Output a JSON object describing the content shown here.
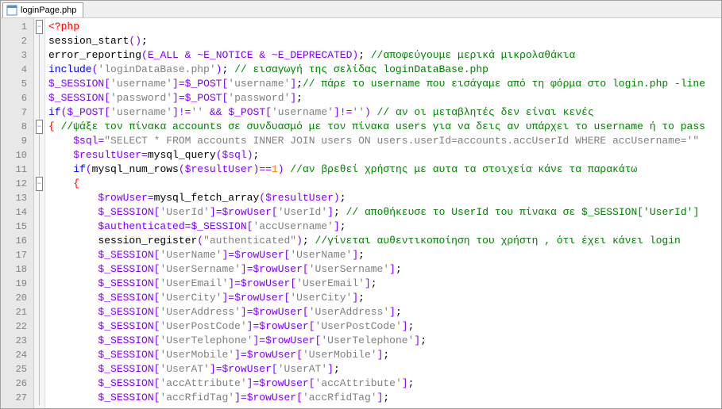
{
  "tab": {
    "filename": "loginPage.php"
  },
  "lines": [
    {
      "n": 1,
      "fold": "minus",
      "tokens": [
        [
          "c-tag",
          "<?php"
        ]
      ]
    },
    {
      "n": 2,
      "fold": "line",
      "tokens": [
        [
          "",
          "session_start"
        ],
        [
          "c-paren",
          "()"
        ],
        [
          "c-punc",
          ";"
        ]
      ]
    },
    {
      "n": 3,
      "fold": "line",
      "tokens": [
        [
          "",
          "error_reporting"
        ],
        [
          "c-paren",
          "("
        ],
        [
          "c-idx",
          "E_ALL"
        ],
        [
          "",
          " "
        ],
        [
          "c-op",
          "&"
        ],
        [
          "",
          " "
        ],
        [
          "c-op",
          "~"
        ],
        [
          "c-idx",
          "E_NOTICE"
        ],
        [
          "",
          " "
        ],
        [
          "c-op",
          "&"
        ],
        [
          "",
          " "
        ],
        [
          "c-op",
          "~"
        ],
        [
          "c-idx",
          "E_DEPRECATED"
        ],
        [
          "c-paren",
          ")"
        ],
        [
          "c-punc",
          ";"
        ],
        [
          "",
          " "
        ],
        [
          "c-com",
          "//αποφεύγουμε μερικά μικρολαθάκια"
        ]
      ]
    },
    {
      "n": 4,
      "fold": "line",
      "tokens": [
        [
          "c-kw",
          "include"
        ],
        [
          "c-paren",
          "("
        ],
        [
          "c-str",
          "'loginDataBase.php'"
        ],
        [
          "c-paren",
          ")"
        ],
        [
          "c-punc",
          ";"
        ],
        [
          "",
          " "
        ],
        [
          "c-com",
          "// εισαγωγή της σελίδας loginDataBase.php"
        ]
      ]
    },
    {
      "n": 5,
      "fold": "line",
      "tokens": [
        [
          "c-idx",
          "$_SESSION"
        ],
        [
          "c-paren",
          "["
        ],
        [
          "c-str",
          "'username'"
        ],
        [
          "c-paren",
          "]"
        ],
        [
          "c-op",
          "="
        ],
        [
          "c-idx",
          "$_POST"
        ],
        [
          "c-paren",
          "["
        ],
        [
          "c-str",
          "'username'"
        ],
        [
          "c-paren",
          "]"
        ],
        [
          "c-punc",
          ";"
        ],
        [
          "c-com",
          "// πάρε το username που εισάγαμε από τη φόρμα στο login.php -line"
        ]
      ]
    },
    {
      "n": 6,
      "fold": "line",
      "tokens": [
        [
          "c-idx",
          "$_SESSION"
        ],
        [
          "c-paren",
          "["
        ],
        [
          "c-str",
          "'password'"
        ],
        [
          "c-paren",
          "]"
        ],
        [
          "c-op",
          "="
        ],
        [
          "c-idx",
          "$_POST"
        ],
        [
          "c-paren",
          "["
        ],
        [
          "c-str",
          "'password'"
        ],
        [
          "c-paren",
          "]"
        ],
        [
          "c-punc",
          ";"
        ]
      ]
    },
    {
      "n": 7,
      "fold": "line",
      "tokens": [
        [
          "c-kw",
          "if"
        ],
        [
          "c-paren",
          "("
        ],
        [
          "c-idx",
          "$_POST"
        ],
        [
          "c-paren",
          "["
        ],
        [
          "c-str",
          "'username'"
        ],
        [
          "c-paren",
          "]"
        ],
        [
          "c-op",
          "!="
        ],
        [
          "c-str",
          "''"
        ],
        [
          "",
          " "
        ],
        [
          "c-op",
          "&&"
        ],
        [
          "",
          " "
        ],
        [
          "c-idx",
          "$_POST"
        ],
        [
          "c-paren",
          "["
        ],
        [
          "c-str",
          "'username'"
        ],
        [
          "c-paren",
          "]"
        ],
        [
          "c-op",
          "!="
        ],
        [
          "c-str",
          "''"
        ],
        [
          "c-paren",
          ")"
        ],
        [
          "",
          " "
        ],
        [
          "c-com",
          "// αν οι μεταβλητές δεν είναι κενές"
        ]
      ]
    },
    {
      "n": 8,
      "fold": "minus",
      "tokens": [
        [
          "c-brace",
          "{"
        ],
        [
          "",
          " "
        ],
        [
          "c-com",
          "//ψάξε τον πίνακα accounts σε συνδυασμό με τον πίνακα users για να δεις αν υπάρχει το username ή το pass"
        ]
      ]
    },
    {
      "n": 9,
      "fold": "line",
      "tokens": [
        [
          "",
          "    "
        ],
        [
          "c-idx",
          "$sql"
        ],
        [
          "c-op",
          "="
        ],
        [
          "c-str",
          "\"SELECT * FROM accounts INNER JOIN users ON users.userId=accounts.accUserId WHERE accUsername='\""
        ]
      ]
    },
    {
      "n": 10,
      "fold": "line",
      "tokens": [
        [
          "",
          "    "
        ],
        [
          "c-idx",
          "$resultUser"
        ],
        [
          "c-op",
          "="
        ],
        [
          "",
          "mysql_query"
        ],
        [
          "c-paren",
          "("
        ],
        [
          "c-idx",
          "$sql"
        ],
        [
          "c-paren",
          ")"
        ],
        [
          "c-punc",
          ";"
        ]
      ]
    },
    {
      "n": 11,
      "fold": "line",
      "tokens": [
        [
          "",
          "    "
        ],
        [
          "c-kw",
          "if"
        ],
        [
          "c-paren",
          "("
        ],
        [
          "",
          "mysql_num_rows"
        ],
        [
          "c-paren",
          "("
        ],
        [
          "c-idx",
          "$resultUser"
        ],
        [
          "c-paren",
          ")"
        ],
        [
          "c-op",
          "=="
        ],
        [
          "c-num",
          "1"
        ],
        [
          "c-paren",
          ")"
        ],
        [
          "",
          " "
        ],
        [
          "c-com",
          "//αν βρεθεί χρήστης με αυτα τα στοιχεία κάνε τα παρακάτω"
        ]
      ]
    },
    {
      "n": 12,
      "fold": "minus",
      "tokens": [
        [
          "",
          "    "
        ],
        [
          "c-brace",
          "{"
        ]
      ]
    },
    {
      "n": 13,
      "fold": "line",
      "tokens": [
        [
          "",
          "        "
        ],
        [
          "c-idx",
          "$rowUser"
        ],
        [
          "c-op",
          "="
        ],
        [
          "",
          "mysql_fetch_array"
        ],
        [
          "c-paren",
          "("
        ],
        [
          "c-idx",
          "$resultUser"
        ],
        [
          "c-paren",
          ")"
        ],
        [
          "c-punc",
          ";"
        ]
      ]
    },
    {
      "n": 14,
      "fold": "line",
      "tokens": [
        [
          "",
          "        "
        ],
        [
          "c-idx",
          "$_SESSION"
        ],
        [
          "c-paren",
          "["
        ],
        [
          "c-str",
          "'UserId'"
        ],
        [
          "c-paren",
          "]"
        ],
        [
          "c-op",
          "="
        ],
        [
          "c-idx",
          "$rowUser"
        ],
        [
          "c-paren",
          "["
        ],
        [
          "c-str",
          "'UserId'"
        ],
        [
          "c-paren",
          "]"
        ],
        [
          "c-punc",
          ";"
        ],
        [
          "",
          " "
        ],
        [
          "c-com",
          "// αποθήκευσε το UserId του πίνακα σε $_SESSION['UserId']"
        ]
      ]
    },
    {
      "n": 15,
      "fold": "line",
      "tokens": [
        [
          "",
          "        "
        ],
        [
          "c-idx",
          "$authenticated"
        ],
        [
          "c-op",
          "="
        ],
        [
          "c-idx",
          "$_SESSION"
        ],
        [
          "c-paren",
          "["
        ],
        [
          "c-str",
          "'accUsername'"
        ],
        [
          "c-paren",
          "]"
        ],
        [
          "c-punc",
          ";"
        ]
      ]
    },
    {
      "n": 16,
      "fold": "line",
      "tokens": [
        [
          "",
          "        "
        ],
        [
          "",
          "session_register"
        ],
        [
          "c-paren",
          "("
        ],
        [
          "c-str",
          "\"authenticated\""
        ],
        [
          "c-paren",
          ")"
        ],
        [
          "c-punc",
          ";"
        ],
        [
          "",
          " "
        ],
        [
          "c-com",
          "//γίνεται αυθεντικοποίηση του χρήστη , ότι έχει κάνει login"
        ]
      ]
    },
    {
      "n": 17,
      "fold": "line",
      "tokens": [
        [
          "",
          "        "
        ],
        [
          "c-idx",
          "$_SESSION"
        ],
        [
          "c-paren",
          "["
        ],
        [
          "c-str",
          "'UserName'"
        ],
        [
          "c-paren",
          "]"
        ],
        [
          "c-op",
          "="
        ],
        [
          "c-idx",
          "$rowUser"
        ],
        [
          "c-paren",
          "["
        ],
        [
          "c-str",
          "'UserName'"
        ],
        [
          "c-paren",
          "]"
        ],
        [
          "c-punc",
          ";"
        ]
      ]
    },
    {
      "n": 18,
      "fold": "line",
      "tokens": [
        [
          "",
          "        "
        ],
        [
          "c-idx",
          "$_SESSION"
        ],
        [
          "c-paren",
          "["
        ],
        [
          "c-str",
          "'UserSername'"
        ],
        [
          "c-paren",
          "]"
        ],
        [
          "c-op",
          "="
        ],
        [
          "c-idx",
          "$rowUser"
        ],
        [
          "c-paren",
          "["
        ],
        [
          "c-str",
          "'UserSername'"
        ],
        [
          "c-paren",
          "]"
        ],
        [
          "c-punc",
          ";"
        ]
      ]
    },
    {
      "n": 19,
      "fold": "line",
      "tokens": [
        [
          "",
          "        "
        ],
        [
          "c-idx",
          "$_SESSION"
        ],
        [
          "c-paren",
          "["
        ],
        [
          "c-str",
          "'UserEmail'"
        ],
        [
          "c-paren",
          "]"
        ],
        [
          "c-op",
          "="
        ],
        [
          "c-idx",
          "$rowUser"
        ],
        [
          "c-paren",
          "["
        ],
        [
          "c-str",
          "'UserEmail'"
        ],
        [
          "c-paren",
          "]"
        ],
        [
          "c-punc",
          ";"
        ]
      ]
    },
    {
      "n": 20,
      "fold": "line",
      "tokens": [
        [
          "",
          "        "
        ],
        [
          "c-idx",
          "$_SESSION"
        ],
        [
          "c-paren",
          "["
        ],
        [
          "c-str",
          "'UserCity'"
        ],
        [
          "c-paren",
          "]"
        ],
        [
          "c-op",
          "="
        ],
        [
          "c-idx",
          "$rowUser"
        ],
        [
          "c-paren",
          "["
        ],
        [
          "c-str",
          "'UserCity'"
        ],
        [
          "c-paren",
          "]"
        ],
        [
          "c-punc",
          ";"
        ]
      ]
    },
    {
      "n": 21,
      "fold": "line",
      "tokens": [
        [
          "",
          "        "
        ],
        [
          "c-idx",
          "$_SESSION"
        ],
        [
          "c-paren",
          "["
        ],
        [
          "c-str",
          "'UserAddress'"
        ],
        [
          "c-paren",
          "]"
        ],
        [
          "c-op",
          "="
        ],
        [
          "c-idx",
          "$rowUser"
        ],
        [
          "c-paren",
          "["
        ],
        [
          "c-str",
          "'UserAddress'"
        ],
        [
          "c-paren",
          "]"
        ],
        [
          "c-punc",
          ";"
        ]
      ]
    },
    {
      "n": 22,
      "fold": "line",
      "tokens": [
        [
          "",
          "        "
        ],
        [
          "c-idx",
          "$_SESSION"
        ],
        [
          "c-paren",
          "["
        ],
        [
          "c-str",
          "'UserPostCode'"
        ],
        [
          "c-paren",
          "]"
        ],
        [
          "c-op",
          "="
        ],
        [
          "c-idx",
          "$rowUser"
        ],
        [
          "c-paren",
          "["
        ],
        [
          "c-str",
          "'UserPostCode'"
        ],
        [
          "c-paren",
          "]"
        ],
        [
          "c-punc",
          ";"
        ]
      ]
    },
    {
      "n": 23,
      "fold": "line",
      "tokens": [
        [
          "",
          "        "
        ],
        [
          "c-idx",
          "$_SESSION"
        ],
        [
          "c-paren",
          "["
        ],
        [
          "c-str",
          "'UserTelephone'"
        ],
        [
          "c-paren",
          "]"
        ],
        [
          "c-op",
          "="
        ],
        [
          "c-idx",
          "$rowUser"
        ],
        [
          "c-paren",
          "["
        ],
        [
          "c-str",
          "'UserTelephone'"
        ],
        [
          "c-paren",
          "]"
        ],
        [
          "c-punc",
          ";"
        ]
      ]
    },
    {
      "n": 24,
      "fold": "line",
      "tokens": [
        [
          "",
          "        "
        ],
        [
          "c-idx",
          "$_SESSION"
        ],
        [
          "c-paren",
          "["
        ],
        [
          "c-str",
          "'UserMobile'"
        ],
        [
          "c-paren",
          "]"
        ],
        [
          "c-op",
          "="
        ],
        [
          "c-idx",
          "$rowUser"
        ],
        [
          "c-paren",
          "["
        ],
        [
          "c-str",
          "'UserMobile'"
        ],
        [
          "c-paren",
          "]"
        ],
        [
          "c-punc",
          ";"
        ]
      ]
    },
    {
      "n": 25,
      "fold": "line",
      "tokens": [
        [
          "",
          "        "
        ],
        [
          "c-idx",
          "$_SESSION"
        ],
        [
          "c-paren",
          "["
        ],
        [
          "c-str",
          "'UserAT'"
        ],
        [
          "c-paren",
          "]"
        ],
        [
          "c-op",
          "="
        ],
        [
          "c-idx",
          "$rowUser"
        ],
        [
          "c-paren",
          "["
        ],
        [
          "c-str",
          "'UserAT'"
        ],
        [
          "c-paren",
          "]"
        ],
        [
          "c-punc",
          ";"
        ]
      ]
    },
    {
      "n": 26,
      "fold": "line",
      "tokens": [
        [
          "",
          "        "
        ],
        [
          "c-idx",
          "$_SESSION"
        ],
        [
          "c-paren",
          "["
        ],
        [
          "c-str",
          "'accAttribute'"
        ],
        [
          "c-paren",
          "]"
        ],
        [
          "c-op",
          "="
        ],
        [
          "c-idx",
          "$rowUser"
        ],
        [
          "c-paren",
          "["
        ],
        [
          "c-str",
          "'accAttribute'"
        ],
        [
          "c-paren",
          "]"
        ],
        [
          "c-punc",
          ";"
        ]
      ]
    },
    {
      "n": 27,
      "fold": "line",
      "tokens": [
        [
          "",
          "        "
        ],
        [
          "c-idx",
          "$_SESSION"
        ],
        [
          "c-paren",
          "["
        ],
        [
          "c-str",
          "'accRfidTag'"
        ],
        [
          "c-paren",
          "]"
        ],
        [
          "c-op",
          "="
        ],
        [
          "c-idx",
          "$rowUser"
        ],
        [
          "c-paren",
          "["
        ],
        [
          "c-str",
          "'accRfidTag'"
        ],
        [
          "c-paren",
          "]"
        ],
        [
          "c-punc",
          ";"
        ]
      ]
    }
  ]
}
